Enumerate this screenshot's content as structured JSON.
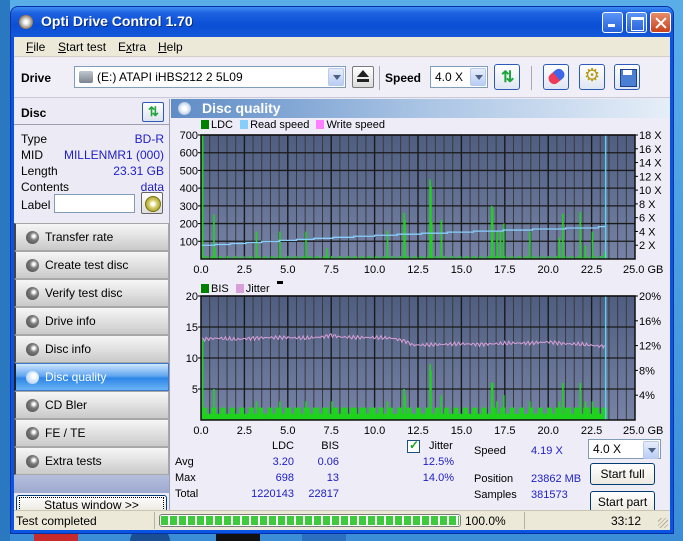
{
  "window": {
    "title": "Opti Drive Control 1.70"
  },
  "menu": [
    {
      "label": "File",
      "accel": "F",
      "rest": "ile"
    },
    {
      "label": "Start test",
      "accel": "S",
      "rest": "tart test"
    },
    {
      "label": "Extra",
      "accel": "E",
      "rest": "xtra",
      "accel_pos": 1
    },
    {
      "label": "Help",
      "accel": "H",
      "rest": "elp"
    }
  ],
  "toolbar": {
    "drive_label": "Drive",
    "drive_value": "(E:)   ATAPI iHBS212   2 5L09",
    "speed_label": "Speed",
    "speed_value": "4.0 X"
  },
  "disc": {
    "header": "Disc",
    "rows": [
      {
        "key": "Type",
        "value": "BD-R"
      },
      {
        "key": "MID",
        "value": "MILLENMR1 (000)"
      },
      {
        "key": "Length",
        "value": "23.31 GB"
      },
      {
        "key": "Contents",
        "value": "data"
      }
    ],
    "label_key": "Label",
    "label_value": ""
  },
  "nav": [
    {
      "label": "Transfer rate",
      "active": false
    },
    {
      "label": "Create test disc",
      "active": false
    },
    {
      "label": "Verify test disc",
      "active": false
    },
    {
      "label": "Drive info",
      "active": false
    },
    {
      "label": "Disc info",
      "active": false
    },
    {
      "label": "Disc quality",
      "active": true
    },
    {
      "label": "CD Bler",
      "active": false
    },
    {
      "label": "FE / TE",
      "active": false
    },
    {
      "label": "Extra tests",
      "active": false
    }
  ],
  "status_window_label": "Status window >>",
  "section_title": "Disc quality",
  "colors": {
    "ldc": "#008000",
    "read_speed": "#87cefa",
    "write_speed": "#ff80ff",
    "bis": "#008000",
    "jitter": "#d8a0d8",
    "bars": "#1ed21e",
    "plot_bg_top": "#4e5d80",
    "plot_bg_bottom": "#7683a6",
    "position_marker": "#5ad2f0"
  },
  "chart_data": [
    {
      "type": "bar",
      "title": "LDC / Read speed",
      "legend": [
        "LDC",
        "Read speed",
        "Write speed"
      ],
      "legend_position": "top-left",
      "xlabel": "GB",
      "x_ticks": [
        "0.0",
        "2.5",
        "5.0",
        "7.5",
        "10.0",
        "12.5",
        "15.0",
        "17.5",
        "20.0",
        "22.5",
        "25.0 GB"
      ],
      "xlim": [
        0,
        25
      ],
      "y_left_ticks": [
        "100",
        "200",
        "300",
        "400",
        "500",
        "600",
        "700"
      ],
      "ylim_left": [
        0,
        700
      ],
      "y_right_ticks": [
        "2 X",
        "4 X",
        "6 X",
        "8 X",
        "10 X",
        "12 X",
        "14 X",
        "16 X",
        "18 X"
      ],
      "ylim_right": [
        0,
        18
      ],
      "grid": true,
      "ldc_spikes": [
        {
          "x": 0.05,
          "y": 698
        },
        {
          "x": 0.7,
          "y": 250
        },
        {
          "x": 0.75,
          "y": 60
        },
        {
          "x": 3.15,
          "y": 155
        },
        {
          "x": 4.5,
          "y": 155
        },
        {
          "x": 6.0,
          "y": 155
        },
        {
          "x": 7.2,
          "y": 60
        },
        {
          "x": 10.7,
          "y": 160
        },
        {
          "x": 11.65,
          "y": 260
        },
        {
          "x": 11.7,
          "y": 220
        },
        {
          "x": 13.15,
          "y": 450
        },
        {
          "x": 13.2,
          "y": 410
        },
        {
          "x": 13.25,
          "y": 210
        },
        {
          "x": 13.8,
          "y": 220
        },
        {
          "x": 16.7,
          "y": 300
        },
        {
          "x": 16.75,
          "y": 285
        },
        {
          "x": 17.0,
          "y": 160
        },
        {
          "x": 17.2,
          "y": 160
        },
        {
          "x": 17.4,
          "y": 200
        },
        {
          "x": 18.9,
          "y": 155
        },
        {
          "x": 20.6,
          "y": 120
        },
        {
          "x": 20.8,
          "y": 255
        },
        {
          "x": 21.8,
          "y": 265
        },
        {
          "x": 22.1,
          "y": 75
        },
        {
          "x": 22.5,
          "y": 155
        },
        {
          "x": 23.2,
          "y": 40
        }
      ],
      "ldc_baseline": 15,
      "read_speed": {
        "x": [
          0,
          0.8,
          0.8,
          1.7,
          1.7,
          2.6,
          2.6,
          3.5,
          3.5,
          4.5,
          4.5,
          5.5,
          5.5,
          6.5,
          6.5,
          7.6,
          7.6,
          8.8,
          8.8,
          10.0,
          10.0,
          11.3,
          11.3,
          12.7,
          12.7,
          14.2,
          14.2,
          15.7,
          15.7,
          17.4,
          17.4,
          19.1,
          19.1,
          21.0,
          21.0,
          22.9,
          22.9,
          23.31
        ],
        "y": [
          2.0,
          2.0,
          2.1,
          2.1,
          2.25,
          2.25,
          2.4,
          2.4,
          2.55,
          2.55,
          2.7,
          2.7,
          2.85,
          2.85,
          3.0,
          3.0,
          3.15,
          3.15,
          3.3,
          3.3,
          3.45,
          3.45,
          3.6,
          3.6,
          3.75,
          3.75,
          3.9,
          3.9,
          4.05,
          4.05,
          4.2,
          4.2,
          4.35,
          4.35,
          4.5,
          4.5,
          4.7,
          4.7
        ]
      },
      "position_marker_gb": 23.31
    },
    {
      "type": "bar",
      "title": "BIS / Jitter",
      "legend": [
        "BIS",
        "Jitter"
      ],
      "legend_position": "top-left",
      "xlabel": "GB",
      "x_ticks": [
        "0.0",
        "2.5",
        "5.0",
        "7.5",
        "10.0",
        "12.5",
        "15.0",
        "17.5",
        "20.0",
        "22.5",
        "25.0 GB"
      ],
      "xlim": [
        0,
        25
      ],
      "y_left_ticks": [
        "5",
        "10",
        "15",
        "20"
      ],
      "ylim_left": [
        0,
        20
      ],
      "y_right_ticks": [
        "4%",
        "8%",
        "12%",
        "16%",
        "20%"
      ],
      "ylim_right": [
        0,
        20
      ],
      "grid": true,
      "bis_spikes": [
        {
          "x": 0.05,
          "y": 13
        },
        {
          "x": 0.7,
          "y": 5
        },
        {
          "x": 3.15,
          "y": 3
        },
        {
          "x": 4.5,
          "y": 3
        },
        {
          "x": 6.0,
          "y": 3
        },
        {
          "x": 7.5,
          "y": 3
        },
        {
          "x": 10.7,
          "y": 3
        },
        {
          "x": 11.65,
          "y": 5
        },
        {
          "x": 11.7,
          "y": 4
        },
        {
          "x": 13.15,
          "y": 9
        },
        {
          "x": 13.2,
          "y": 8
        },
        {
          "x": 13.8,
          "y": 4
        },
        {
          "x": 16.7,
          "y": 6
        },
        {
          "x": 16.75,
          "y": 6
        },
        {
          "x": 17.0,
          "y": 3
        },
        {
          "x": 17.4,
          "y": 4
        },
        {
          "x": 18.9,
          "y": 3
        },
        {
          "x": 20.6,
          "y": 3
        },
        {
          "x": 20.8,
          "y": 6
        },
        {
          "x": 21.8,
          "y": 6
        },
        {
          "x": 22.1,
          "y": 3
        },
        {
          "x": 22.5,
          "y": 3
        }
      ],
      "bis_baseline": [
        1,
        2
      ],
      "jitter": {
        "x": [
          0,
          1,
          2,
          3,
          4,
          5,
          6,
          7,
          7.5,
          8,
          9,
          10,
          11,
          11.8,
          12.2,
          13,
          14,
          15,
          16,
          17,
          18,
          19,
          20,
          21,
          22,
          23,
          23.31
        ],
        "y": [
          13.0,
          13.2,
          13.0,
          13.2,
          13.3,
          13.3,
          13.2,
          13.4,
          13.7,
          13.4,
          13.3,
          13.3,
          13.2,
          12.7,
          12.1,
          12.1,
          12.2,
          12.3,
          12.2,
          12.3,
          12.4,
          12.4,
          12.6,
          12.3,
          12.2,
          11.9,
          12.0
        ]
      },
      "position_marker_gb": 23.31
    }
  ],
  "stats": {
    "col_ldc": "LDC",
    "col_bis": "BIS",
    "col_jitter": "Jitter",
    "jitter_checked": true,
    "rows": [
      {
        "label": "Avg",
        "ldc": "3.20",
        "bis": "0.06",
        "jitter": "12.5%"
      },
      {
        "label": "Max",
        "ldc": "698",
        "bis": "13",
        "jitter": "14.0%"
      },
      {
        "label": "Total",
        "ldc": "1220143",
        "bis": "22817",
        "jitter": ""
      }
    ]
  },
  "right_panel": {
    "speed_label": "Speed",
    "speed_value": "4.19 X",
    "speed_select": "4.0 X",
    "position_label": "Position",
    "position_value": "23862 MB",
    "samples_label": "Samples",
    "samples_value": "381573",
    "start_full": "Start full",
    "start_part": "Start part"
  },
  "statusbar": {
    "text": "Test completed",
    "progress_percent": 100.0,
    "progress_label": "100.0%",
    "elapsed": "33:12"
  }
}
